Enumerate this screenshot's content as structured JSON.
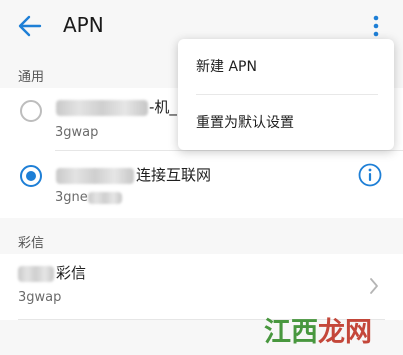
{
  "header": {
    "title": "APN",
    "back_icon": "arrow-left-icon",
    "more_icon": "more-vertical-icon"
  },
  "sections": {
    "general_label": "通用",
    "mms_label": "彩信"
  },
  "apn_rows": [
    {
      "title_visible": "-机_",
      "subtitle": "3gwap",
      "selected": false
    },
    {
      "title_visible": "连接互联网",
      "subtitle": "3gne",
      "selected": true
    }
  ],
  "mms_row": {
    "title_visible": "彩信",
    "subtitle": "3gwap"
  },
  "menu": {
    "items": [
      "新建 APN",
      "重置为默认设置"
    ]
  },
  "watermark": {
    "text": "江西龙网"
  },
  "colors": {
    "accent": "#1e7fd6",
    "watermark_green": "#3a8f2f",
    "watermark_red": "#c0392b"
  }
}
